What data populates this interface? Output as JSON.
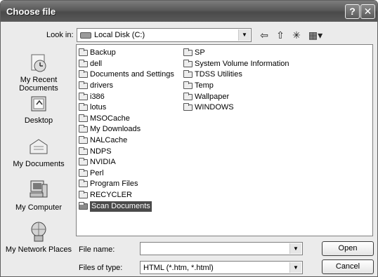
{
  "window": {
    "title": "Choose file",
    "help_glyph": "?",
    "close_glyph": "✕"
  },
  "lookin": {
    "label": "Look in:",
    "value": "Local Disk (C:)",
    "icon": "drive-icon"
  },
  "toolbar": {
    "back_glyph": "⇦",
    "up_glyph": "⇧",
    "new_folder_glyph": "✳",
    "view_menu_glyph": "▦▾"
  },
  "places": [
    {
      "label": "My Recent Documents",
      "icon": "recent-documents-icon"
    },
    {
      "label": "Desktop",
      "icon": "desktop-icon"
    },
    {
      "label": "My Documents",
      "icon": "my-documents-icon"
    },
    {
      "label": "My Computer",
      "icon": "my-computer-icon"
    },
    {
      "label": "My Network Places",
      "icon": "network-places-icon"
    }
  ],
  "files": {
    "col1": [
      "Backup",
      "dell",
      "Documents and Settings",
      "drivers",
      "i386",
      "lotus",
      "MSOCache",
      "My Downloads",
      "NALCache",
      "NDPS",
      "NVIDIA",
      "Perl",
      "Program Files",
      "RECYCLER",
      "Scan Documents"
    ],
    "col2": [
      "SP",
      "System Volume Information",
      "TDSS Utilities",
      "Temp",
      "Wallpaper",
      "WINDOWS"
    ],
    "selected": "Scan Documents"
  },
  "filename": {
    "label": "File name:",
    "value": ""
  },
  "filetype": {
    "label": "Files of type:",
    "value": "HTML (*.htm, *.html)"
  },
  "buttons": {
    "open": "Open",
    "cancel": "Cancel"
  },
  "colors": {
    "titlebar": "#595959",
    "selection": "#4a4a4a",
    "dialog_bg": "#ebebeb"
  }
}
